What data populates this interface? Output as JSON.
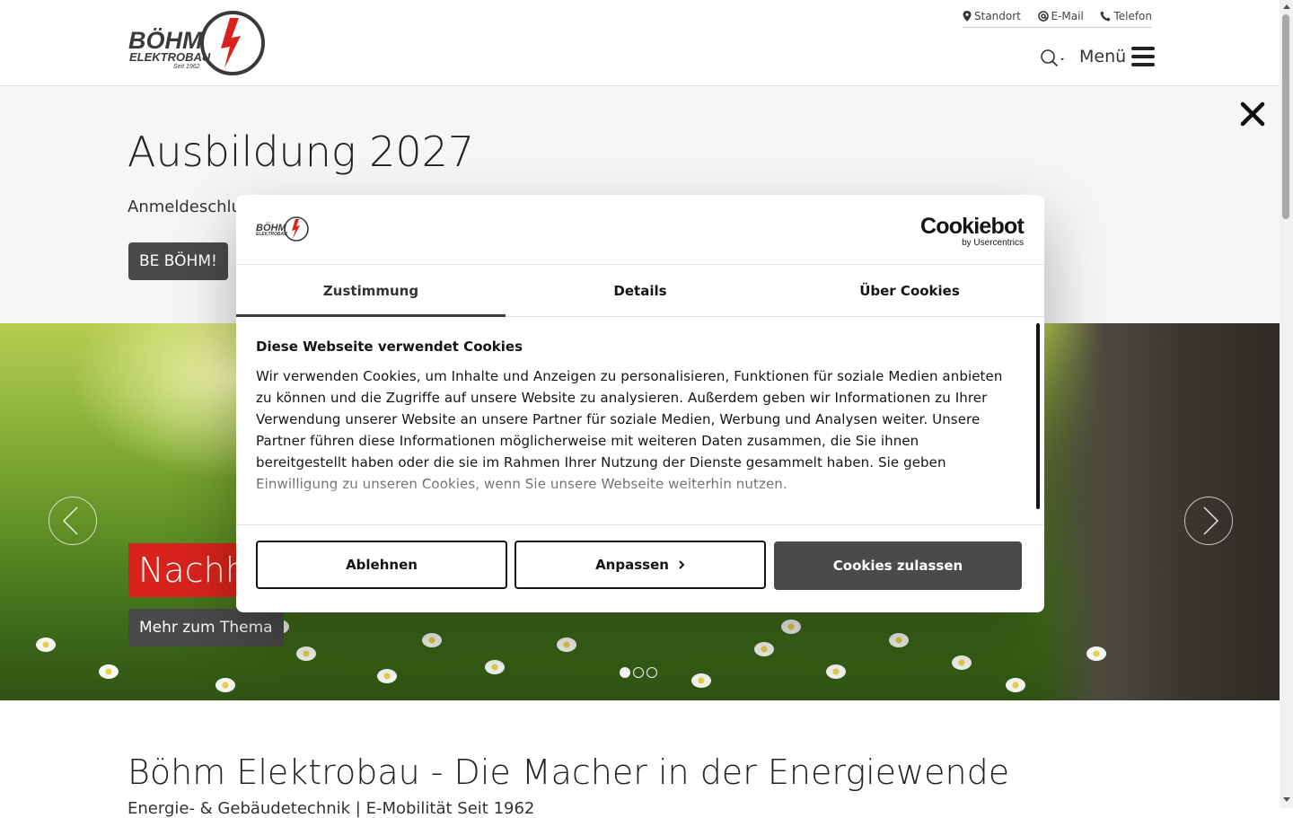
{
  "header": {
    "logo_alt": "BÖHM ELEKTROBAU Seit 1962",
    "logo_brand": "BÖHM",
    "logo_sub": "ELEKTROBAU",
    "logo_since": "Seit 1962",
    "links": [
      {
        "label": "Standort",
        "icon": "map-pin-icon"
      },
      {
        "label": "E-Mail",
        "icon": "at-icon"
      },
      {
        "label": "Telefon",
        "icon": "phone-icon"
      }
    ],
    "menu_label": "Menü"
  },
  "banner": {
    "title": "Ausbildung 2027",
    "text": "Anmeldeschlu",
    "button_label": "BE BÖHM!"
  },
  "slider": {
    "title": "Nachh",
    "button_label": "Mehr zum Thema",
    "slide_count": 3,
    "active_slide": 1
  },
  "intro": {
    "title": "Böhm Elektrobau - Die Macher in der Energiewende",
    "subtitle": "Energie- & Gebäudetechnik | E-Mobilität Seit 1962"
  },
  "cookie": {
    "brand": "Cookiebot",
    "brand_sub": "by Usercentrics",
    "tabs": [
      {
        "label": "Zustimmung",
        "active": true
      },
      {
        "label": "Details",
        "active": false
      },
      {
        "label": "Über Cookies",
        "active": false
      }
    ],
    "heading": "Diese Webseite verwendet Cookies",
    "text": "Wir verwenden Cookies, um Inhalte und Anzeigen zu personalisieren, Funktionen für soziale Medien anbieten zu können und die Zugriffe auf unsere Website zu analysieren. Außerdem geben wir Informationen zu Ihrer Verwendung unserer Website an unsere Partner für soziale Medien, Werbung und Analysen weiter. Unsere Partner führen diese Informationen möglicherweise mit weiteren Daten zusammen, die Sie ihnen bereitgestellt haben oder die sie im Rahmen Ihrer Nutzung der Dienste gesammelt haben. Sie geben Einwilligung zu unseren Cookies, wenn Sie unsere Webseite weiterhin nutzen.",
    "buttons": {
      "decline": "Ablehnen",
      "customize": "Anpassen",
      "accept": "Cookies zulassen"
    }
  },
  "colors": {
    "accent_red": "#d8231c",
    "button_dark": "#4a4a4a",
    "text_dark": "#141414"
  }
}
